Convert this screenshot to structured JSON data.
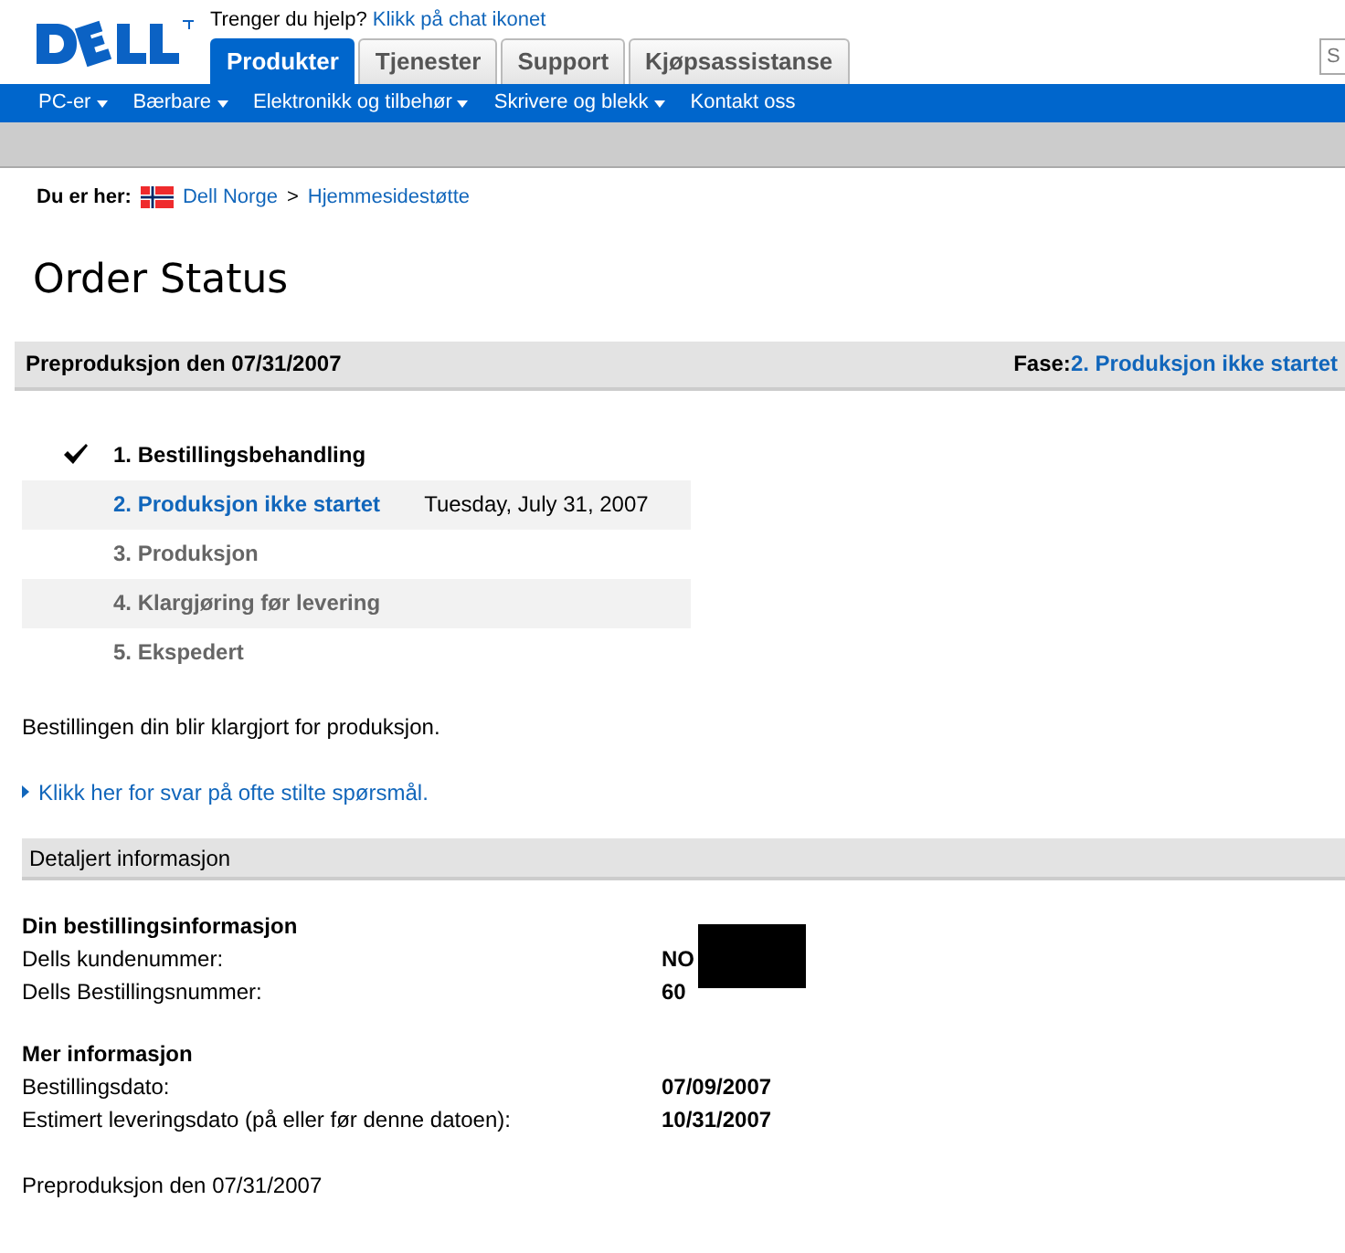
{
  "header": {
    "help_text": "Trenger du hjelp?",
    "help_link": "Klikk på chat ikonet",
    "search": {
      "placeholder": "S"
    }
  },
  "tabs": [
    {
      "label": "Produkter",
      "selected": true
    },
    {
      "label": "Tjenester",
      "selected": false
    },
    {
      "label": "Support",
      "selected": false
    },
    {
      "label": "Kjøpsassistanse",
      "selected": false
    }
  ],
  "nav": [
    {
      "label": "PC-er",
      "dropdown": true
    },
    {
      "label": "Bærbare",
      "dropdown": true
    },
    {
      "label": "Elektronikk og tilbehør",
      "dropdown": true
    },
    {
      "label": "Skrivere og blekk",
      "dropdown": true
    },
    {
      "label": "Kontakt oss",
      "dropdown": false
    }
  ],
  "breadcrumb": {
    "label": "Du er her:",
    "items": [
      "Dell Norge",
      "Hjemmesidestøtte"
    ],
    "separator": ">"
  },
  "title": "Order Status",
  "status_bar": {
    "left": "Preproduksjon den 07/31/2007",
    "phase_label": "Fase:",
    "phase_value": "2. Produksjon ikke startet"
  },
  "steps": [
    {
      "label": "1. Bestillingsbehandling",
      "completed": true,
      "current": false
    },
    {
      "label": "2. Produksjon ikke startet",
      "completed": false,
      "current": true,
      "date": "Tuesday, July 31, 2007"
    },
    {
      "label": "3. Produksjon",
      "completed": false,
      "current": false
    },
    {
      "label": "4. Klargjøring før levering",
      "completed": false,
      "current": false
    },
    {
      "label": "5. Ekspedert",
      "completed": false,
      "current": false
    }
  ],
  "message": "Bestillingen din blir klargjort for produksjon.",
  "faq_link": "Klikk her for svar på ofte stilte spørsmål.",
  "details": {
    "heading": "Detaljert informasjon",
    "groups": [
      {
        "title": "Din bestillingsinformasjon",
        "rows": [
          {
            "label": "Dells kundenummer:",
            "value": "NO",
            "redacted": true
          },
          {
            "label": "Dells Bestillingsnummer:",
            "value": "60",
            "redacted": true
          }
        ]
      },
      {
        "title": "Mer informasjon",
        "rows": [
          {
            "label": "Bestillingsdato:",
            "value": "07/09/2007"
          },
          {
            "label": "Estimert leveringsdato (på eller før denne datoen):",
            "value": "10/31/2007"
          }
        ]
      }
    ]
  },
  "footer_text": "Preproduksjon den 07/31/2007"
}
